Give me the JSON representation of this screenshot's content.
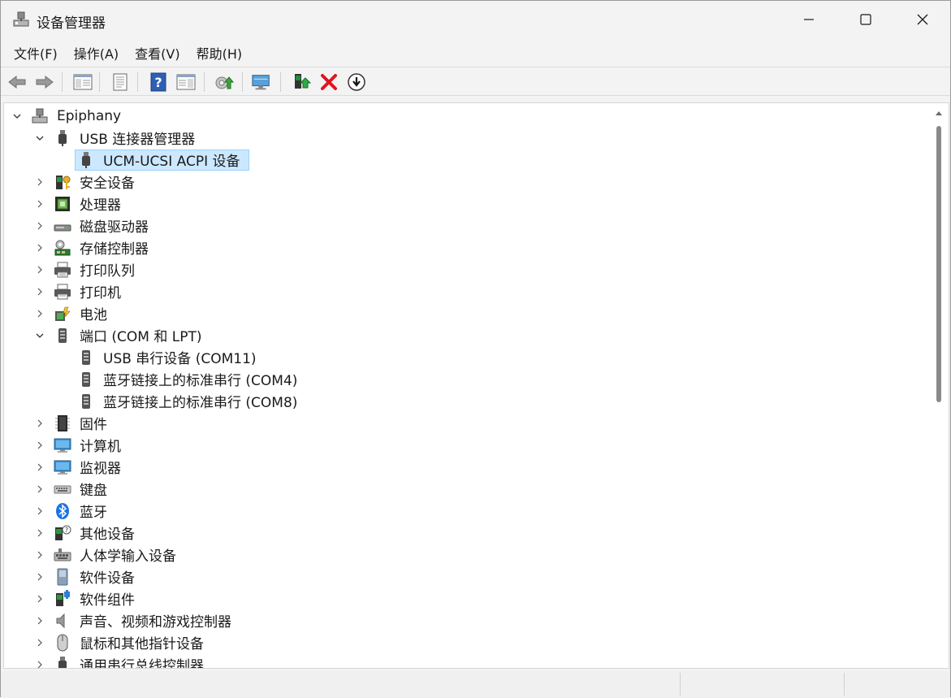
{
  "window": {
    "title": "设备管理器"
  },
  "menu": [
    "文件(F)",
    "操作(A)",
    "查看(V)",
    "帮助(H)"
  ],
  "toolbar": {
    "buttons": [
      "back-icon",
      "forward-icon",
      "show-hide-console-tree-icon",
      "properties-icon",
      "help-icon",
      "action-pane-icon",
      "update-driver-icon",
      "scan-hardware-icon",
      "enable-device-icon",
      "uninstall-device-icon",
      "disable-device-icon"
    ]
  },
  "tree": {
    "root": "Epiphany",
    "items": [
      {
        "label": "USB 连接器管理器",
        "icon": "usb-icon",
        "expanded": true
      },
      {
        "label": "UCM-UCSI ACPI 设备",
        "icon": "usb-icon",
        "child": true,
        "selected": true
      },
      {
        "label": "安全设备",
        "icon": "security-device-icon"
      },
      {
        "label": "处理器",
        "icon": "processor-icon"
      },
      {
        "label": "磁盘驱动器",
        "icon": "disk-drive-icon"
      },
      {
        "label": "存储控制器",
        "icon": "storage-controller-icon"
      },
      {
        "label": "打印队列",
        "icon": "print-queue-icon"
      },
      {
        "label": "打印机",
        "icon": "printer-icon"
      },
      {
        "label": "电池",
        "icon": "battery-icon"
      },
      {
        "label": "端口 (COM 和 LPT)",
        "icon": "port-icon",
        "expanded": true
      },
      {
        "label": "USB 串行设备 (COM11)",
        "icon": "port-icon",
        "child": true
      },
      {
        "label": "蓝牙链接上的标准串行 (COM4)",
        "icon": "port-icon",
        "child": true
      },
      {
        "label": "蓝牙链接上的标准串行 (COM8)",
        "icon": "port-icon",
        "child": true
      },
      {
        "label": "固件",
        "icon": "firmware-icon"
      },
      {
        "label": "计算机",
        "icon": "computer-icon"
      },
      {
        "label": "监视器",
        "icon": "monitor-icon"
      },
      {
        "label": "键盘",
        "icon": "keyboard-icon"
      },
      {
        "label": "蓝牙",
        "icon": "bluetooth-icon"
      },
      {
        "label": "其他设备",
        "icon": "other-devices-icon"
      },
      {
        "label": "人体学输入设备",
        "icon": "hid-icon"
      },
      {
        "label": "软件设备",
        "icon": "software-device-icon"
      },
      {
        "label": "软件组件",
        "icon": "software-component-icon"
      },
      {
        "label": "声音、视频和游戏控制器",
        "icon": "sound-icon"
      },
      {
        "label": "鼠标和其他指针设备",
        "icon": "mouse-icon"
      },
      {
        "label": "通用串行总线控制器",
        "icon": "usb-icon"
      }
    ]
  },
  "colors": {
    "selection": "#cce8ff",
    "selection_border": "#99d1ff",
    "window_bg": "#f3f3f3",
    "pane_bg": "#ffffff"
  }
}
